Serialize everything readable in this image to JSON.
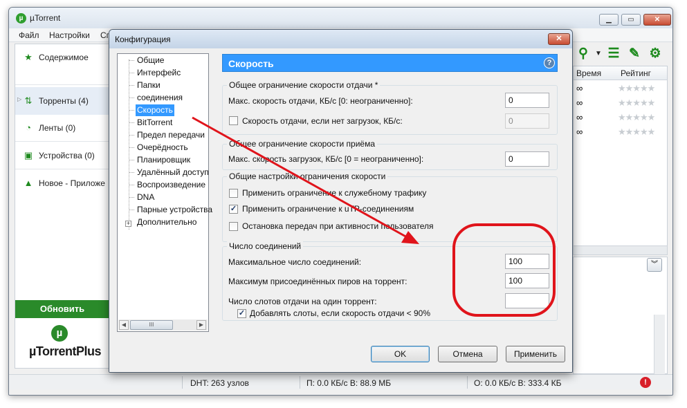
{
  "app": {
    "title": "µTorrent",
    "icon_letter": "µ",
    "window_buttons": {
      "minimize": "▁",
      "maximize": "▭",
      "close": "✕"
    }
  },
  "menu": {
    "items": [
      "Файл",
      "Настройки",
      "Сп"
    ]
  },
  "sidebar": {
    "items": [
      {
        "label": "Содержимое",
        "icon": "star-icon"
      },
      {
        "label": "Торренты (4)",
        "icon": "torrents-icon"
      },
      {
        "label": "Ленты (0)",
        "icon": "rss-icon"
      },
      {
        "label": "Устройства (0)",
        "icon": "devices-icon"
      },
      {
        "label": "Новое - Приложе",
        "icon": "apps-icon"
      }
    ],
    "update_button": "Обновить",
    "plus_logo": "µTorrentPlus"
  },
  "toolbar": {
    "icons": [
      "search-icon",
      "dropdown-icon",
      "list-view-icon",
      "remote-icon",
      "gear-icon"
    ]
  },
  "torrent_list": {
    "columns": [
      "Время",
      "Рейтинг"
    ],
    "rows": [
      {
        "time": "∞",
        "rating": "★★★★★"
      },
      {
        "time": "∞",
        "rating": "★★★★★"
      },
      {
        "time": "∞",
        "rating": "★★★★★"
      },
      {
        "time": "∞",
        "rating": "★★★★★"
      }
    ]
  },
  "statusbar": {
    "dht": "DHT: 263 узлов",
    "download": "П: 0.0 КБ/с В: 88.9 МБ",
    "upload": "О: 0.0 КБ/с В: 333.4 КБ",
    "alert": "!"
  },
  "dialog": {
    "title": "Конфигурация",
    "close": "✕",
    "tree": {
      "items": [
        "Общие",
        "Интерфейс",
        "Папки",
        "соединения",
        "Скорость",
        "BitTorrent",
        "Предел передачи",
        "Очерёдность",
        "Планировщик",
        "Удалённый доступ",
        "Воспроизведение",
        "DNA",
        "Парные устройства",
        "Дополнительно"
      ],
      "selected": "Скорость",
      "expander": "+",
      "scroll_thumb": "III"
    },
    "page": {
      "title": "Скорость",
      "help": "?",
      "upload_group": {
        "title": "Общее ограничение скорости отдачи *",
        "max_label": "Макс. скорость отдачи, КБ/с [0: неограниченно]:",
        "max_value": "0",
        "no_download_label": "Скорость отдачи, если нет загрузок, КБ/с:",
        "no_download_checked": false,
        "no_download_value": "0"
      },
      "download_group": {
        "title": "Общее ограничение скорости приёма",
        "max_label": "Макс. скорость загрузок, КБ/с [0 = неограниченно]:",
        "max_value": "0"
      },
      "global_group": {
        "title": "Общие настройки ограничения скорости",
        "overhead_label": "Применить ограничение к служебному трафику",
        "overhead_checked": false,
        "utp_label": "Применить ограничение к uTP-соединениям",
        "utp_checked": true,
        "idle_label": "Остановка передач при активности пользователя",
        "idle_checked": false
      },
      "connections_group": {
        "title": "Число соединений",
        "max_conn_label": "Максимальное число соединений:",
        "max_conn_value": "100",
        "max_peers_label": "Максимум присоединённых пиров на торрент:",
        "max_peers_value": "100",
        "upload_slots_label": "Число слотов отдачи на один торрент:",
        "upload_slots_value": "",
        "extra_slots_label": "Добавлять слоты, если скорость отдачи < 90%",
        "extra_slots_checked": true
      }
    },
    "buttons": {
      "ok": "OK",
      "cancel": "Отмена",
      "apply": "Применить"
    }
  },
  "annotation": {
    "color": "#e0141b"
  },
  "colors": {
    "accent": "#3399ff",
    "brand_green": "#2a8a2a"
  }
}
